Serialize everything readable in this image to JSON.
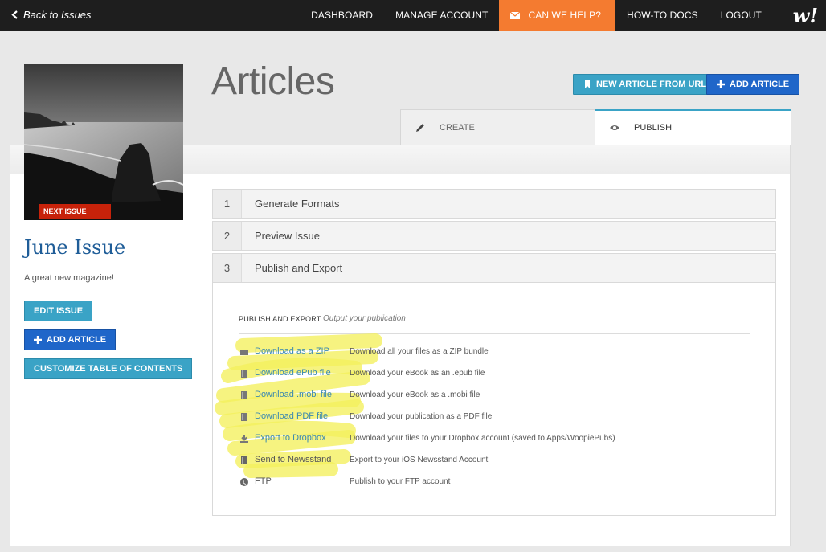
{
  "nav": {
    "back_label": "Back to Issues",
    "links": [
      "DASHBOARD",
      "MANAGE ACCOUNT"
    ],
    "help_label": "CAN WE HELP?",
    "links_right": [
      "HOW-TO DOCS",
      "LOGOUT"
    ],
    "logo": "w!"
  },
  "colors": {
    "help_bg": "#f47b30",
    "teal": "#3aa3c6",
    "blue": "#1f66c9",
    "badge_red": "#c7220a",
    "issue_title": "#1f5d98",
    "highlight_yellow": "#f4f05c"
  },
  "cover": {
    "badge": "NEXT ISSUE"
  },
  "page": {
    "title": "Articles",
    "new_from_url_label": "NEW ARTICLE FROM URL",
    "add_article_label": "ADD ARTICLE"
  },
  "tabs": {
    "create": "CREATE",
    "publish": "PUBLISH"
  },
  "issue": {
    "title": "June Issue",
    "description": "A great new magazine!",
    "edit_label": "EDIT ISSUE",
    "add_article_label": "ADD ARTICLE",
    "customize_label": "CUSTOMIZE TABLE OF CONTENTS"
  },
  "steps": [
    {
      "num": "1",
      "label": "Generate Formats"
    },
    {
      "num": "2",
      "label": "Preview Issue"
    },
    {
      "num": "3",
      "label": "Publish and Export"
    }
  ],
  "publish": {
    "section_title": "PUBLISH AND EXPORT",
    "section_subtitle": "Output your publication",
    "items": [
      {
        "icon": "folder-icon",
        "label": "Download as a ZIP",
        "desc": "Download all your files as a ZIP bundle"
      },
      {
        "icon": "book-icon",
        "label": "Download ePub file",
        "desc": "Download your eBook as an .epub file"
      },
      {
        "icon": "book-icon",
        "label": "Download .mobi file",
        "desc": "Download your eBook as a .mobi file"
      },
      {
        "icon": "book-icon",
        "label": "Download PDF file",
        "desc": "Download your publication as a PDF file"
      },
      {
        "icon": "download-icon",
        "label": "Export to Dropbox",
        "desc": "Download your files to your Dropbox account (saved to Apps/WoopiePubs)"
      },
      {
        "icon": "book-icon",
        "label": "Send to Newsstand",
        "desc": "Export to your iOS Newsstand Account"
      },
      {
        "icon": "globe-icon",
        "label": "FTP",
        "desc": "Publish to your FTP account"
      }
    ]
  }
}
